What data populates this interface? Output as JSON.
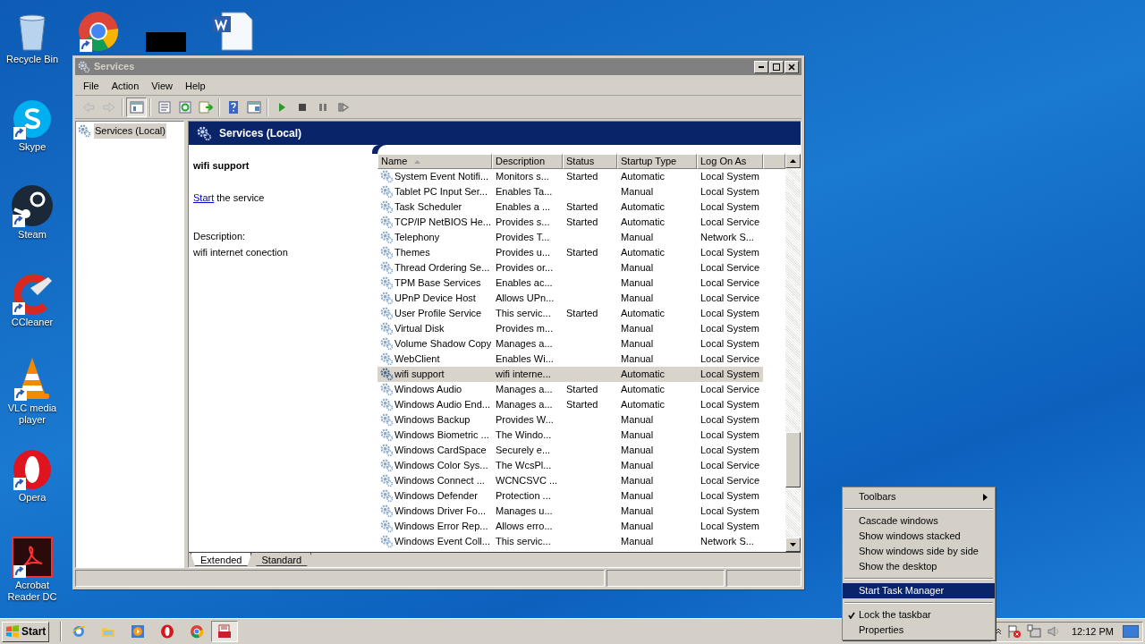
{
  "desktop_icons": [
    {
      "kind": "recycle",
      "label": "Recycle Bin"
    },
    {
      "kind": "chrome"
    },
    {
      "kind": "redacted"
    },
    {
      "kind": "word"
    },
    {
      "kind": "skype",
      "label": "Skype"
    },
    {
      "kind": "steam",
      "label": "Steam"
    },
    {
      "kind": "ccleaner",
      "label": "CCleaner"
    },
    {
      "kind": "vlc",
      "label": "VLC media player"
    },
    {
      "kind": "opera",
      "label": "Opera"
    },
    {
      "kind": "acrobat",
      "label": "Acrobat Reader DC"
    }
  ],
  "window": {
    "title": "Services",
    "menu": [
      "File",
      "Action",
      "View",
      "Help"
    ],
    "toolbar": [
      {
        "kind": "back",
        "disabled": true,
        "pressed": false
      },
      {
        "kind": "forward",
        "disabled": true,
        "pressed": false
      },
      {
        "kind": "sep"
      },
      {
        "kind": "tree",
        "disabled": false,
        "pressed": true
      },
      {
        "kind": "sep"
      },
      {
        "kind": "properties",
        "disabled": false,
        "pressed": false
      },
      {
        "kind": "refresh",
        "disabled": false,
        "pressed": false
      },
      {
        "kind": "export",
        "disabled": false,
        "pressed": false
      },
      {
        "kind": "sep"
      },
      {
        "kind": "help",
        "disabled": false,
        "pressed": false
      },
      {
        "kind": "view",
        "disabled": false,
        "pressed": false
      },
      {
        "kind": "sep"
      },
      {
        "kind": "play",
        "disabled": false,
        "pressed": false
      },
      {
        "kind": "stop",
        "disabled": false,
        "pressed": false
      },
      {
        "kind": "pause",
        "disabled": false,
        "pressed": false
      },
      {
        "kind": "resume",
        "disabled": false,
        "pressed": false
      }
    ],
    "tree": [
      {
        "label": "Services (Local)",
        "selected": true
      }
    ],
    "header": "Services (Local)",
    "detail": {
      "name": "wifi support",
      "action_link": "Start",
      "action_rest": "the service",
      "description_label": "Description:",
      "description": "wifi internet conection"
    },
    "table": {
      "columns": [
        {
          "label": "Name",
          "sorted": true
        },
        {
          "label": "Description",
          "sorted": false
        },
        {
          "label": "Status",
          "sorted": false
        },
        {
          "label": "Startup Type",
          "sorted": false
        },
        {
          "label": "Log On As",
          "sorted": false
        }
      ],
      "rows": [
        {
          "cells": [
            "System Event Notifi...",
            "Monitors s...",
            "Started",
            "Automatic",
            "Local System"
          ],
          "selected": false
        },
        {
          "cells": [
            "Tablet PC Input Ser...",
            "Enables Ta...",
            "",
            "Manual",
            "Local System"
          ],
          "selected": false
        },
        {
          "cells": [
            "Task Scheduler",
            "Enables a ...",
            "Started",
            "Automatic",
            "Local System"
          ],
          "selected": false
        },
        {
          "cells": [
            "TCP/IP NetBIOS He...",
            "Provides s...",
            "Started",
            "Automatic",
            "Local Service"
          ],
          "selected": false
        },
        {
          "cells": [
            "Telephony",
            "Provides T...",
            "",
            "Manual",
            "Network S..."
          ],
          "selected": false
        },
        {
          "cells": [
            "Themes",
            "Provides u...",
            "Started",
            "Automatic",
            "Local System"
          ],
          "selected": false
        },
        {
          "cells": [
            "Thread Ordering Se...",
            "Provides or...",
            "",
            "Manual",
            "Local Service"
          ],
          "selected": false
        },
        {
          "cells": [
            "TPM Base Services",
            "Enables ac...",
            "",
            "Manual",
            "Local Service"
          ],
          "selected": false
        },
        {
          "cells": [
            "UPnP Device Host",
            "Allows UPn...",
            "",
            "Manual",
            "Local Service"
          ],
          "selected": false
        },
        {
          "cells": [
            "User Profile Service",
            "This servic...",
            "Started",
            "Automatic",
            "Local System"
          ],
          "selected": false
        },
        {
          "cells": [
            "Virtual Disk",
            "Provides m...",
            "",
            "Manual",
            "Local System"
          ],
          "selected": false
        },
        {
          "cells": [
            "Volume Shadow Copy",
            "Manages a...",
            "",
            "Manual",
            "Local System"
          ],
          "selected": false
        },
        {
          "cells": [
            "WebClient",
            "Enables Wi...",
            "",
            "Manual",
            "Local Service"
          ],
          "selected": false
        },
        {
          "cells": [
            "wifi support",
            "wifi interne...",
            "",
            "Automatic",
            "Local System"
          ],
          "selected": true
        },
        {
          "cells": [
            "Windows Audio",
            "Manages a...",
            "Started",
            "Automatic",
            "Local Service"
          ],
          "selected": false
        },
        {
          "cells": [
            "Windows Audio End...",
            "Manages a...",
            "Started",
            "Automatic",
            "Local System"
          ],
          "selected": false
        },
        {
          "cells": [
            "Windows Backup",
            "Provides W...",
            "",
            "Manual",
            "Local System"
          ],
          "selected": false
        },
        {
          "cells": [
            "Windows Biometric ...",
            "The Windo...",
            "",
            "Manual",
            "Local System"
          ],
          "selected": false
        },
        {
          "cells": [
            "Windows CardSpace",
            "Securely e...",
            "",
            "Manual",
            "Local System"
          ],
          "selected": false
        },
        {
          "cells": [
            "Windows Color Sys...",
            "The WcsPl...",
            "",
            "Manual",
            "Local Service"
          ],
          "selected": false
        },
        {
          "cells": [
            "Windows Connect ...",
            "WCNCSVC ...",
            "",
            "Manual",
            "Local Service"
          ],
          "selected": false
        },
        {
          "cells": [
            "Windows Defender",
            "Protection ...",
            "",
            "Manual",
            "Local System"
          ],
          "selected": false
        },
        {
          "cells": [
            "Windows Driver Fo...",
            "Manages u...",
            "",
            "Manual",
            "Local System"
          ],
          "selected": false
        },
        {
          "cells": [
            "Windows Error Rep...",
            "Allows erro...",
            "",
            "Manual",
            "Local System"
          ],
          "selected": false
        },
        {
          "cells": [
            "Windows Event Coll...",
            "This servic...",
            "",
            "Manual",
            "Network S..."
          ],
          "selected": false
        }
      ]
    },
    "tabs": [
      {
        "label": "Extended",
        "selected": true
      },
      {
        "label": "Standard",
        "selected": false
      }
    ]
  },
  "context_menu": [
    {
      "kind": "submenu",
      "label": "Toolbars",
      "selected": false,
      "checked": false
    },
    {
      "kind": "separator"
    },
    {
      "kind": "item",
      "label": "Cascade windows",
      "selected": false,
      "checked": false
    },
    {
      "kind": "item",
      "label": "Show windows stacked",
      "selected": false,
      "checked": false
    },
    {
      "kind": "item",
      "label": "Show windows side by side",
      "selected": false,
      "checked": false
    },
    {
      "kind": "item",
      "label": "Show the desktop",
      "selected": false,
      "checked": false
    },
    {
      "kind": "separator"
    },
    {
      "kind": "item",
      "label": "Start Task Manager",
      "selected": true,
      "checked": false
    },
    {
      "kind": "separator"
    },
    {
      "kind": "item",
      "label": "Lock the taskbar",
      "selected": false,
      "checked": true
    },
    {
      "kind": "item",
      "label": "Properties",
      "selected": false,
      "checked": false
    }
  ],
  "taskbar": {
    "start": "Start",
    "apps": [
      {
        "kind": "ie"
      },
      {
        "kind": "explorer"
      },
      {
        "kind": "media"
      },
      {
        "kind": "opera"
      },
      {
        "kind": "chrome"
      },
      {
        "kind": "services",
        "selected": true
      }
    ],
    "clock": "12:12 PM"
  }
}
